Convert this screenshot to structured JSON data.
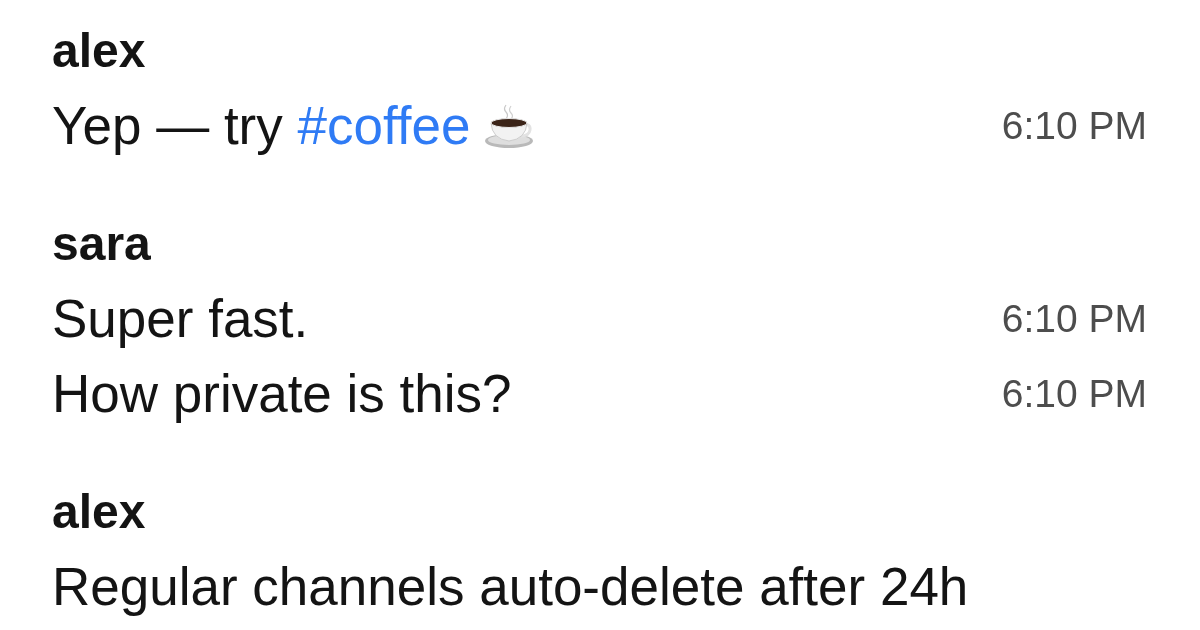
{
  "groups": [
    {
      "author": "alex",
      "messages": [
        {
          "parts": [
            {
              "kind": "text",
              "text": "Yep — try "
            },
            {
              "kind": "link",
              "text": "#coffee"
            },
            {
              "kind": "emoji"
            }
          ],
          "time": "6:10 PM"
        }
      ]
    },
    {
      "author": "sara",
      "messages": [
        {
          "parts": [
            {
              "kind": "text",
              "text": "Super fast."
            }
          ],
          "time": "6:10 PM"
        },
        {
          "parts": [
            {
              "kind": "text",
              "text": "How private is this?"
            }
          ],
          "time": "6:10 PM"
        }
      ]
    },
    {
      "author": "alex",
      "messages": [
        {
          "parts": [
            {
              "kind": "text",
              "text": "Regular channels auto-delete after 24h"
            }
          ]
        }
      ]
    }
  ]
}
